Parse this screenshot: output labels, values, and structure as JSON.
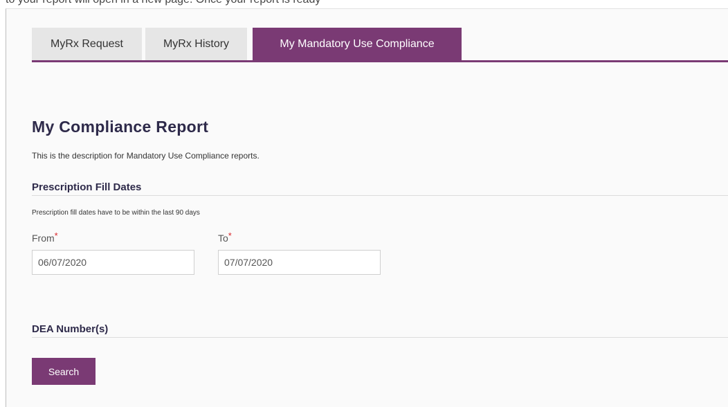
{
  "top_cut_text": "to your report will open in a new page. Once your report is ready",
  "tabs": [
    {
      "label": "MyRx Request",
      "active": false
    },
    {
      "label": "MyRx History",
      "active": false
    },
    {
      "label": "My Mandatory Use Compliance",
      "active": true
    }
  ],
  "report": {
    "title": "My Compliance Report",
    "description": "This is the description for Mandatory Use Compliance reports."
  },
  "fill_dates": {
    "heading": "Prescription Fill Dates",
    "hint": "Prescription fill dates have to be within the last 90 days",
    "from_label": "From",
    "to_label": "To",
    "required_mark": "*",
    "from_value": "06/07/2020",
    "to_value": "07/07/2020"
  },
  "dea": {
    "heading": "DEA Number(s)"
  },
  "actions": {
    "search_label": "Search"
  },
  "colors": {
    "accent": "#7a3a74",
    "required": "#d9262b",
    "heading": "#2e2a4a"
  }
}
